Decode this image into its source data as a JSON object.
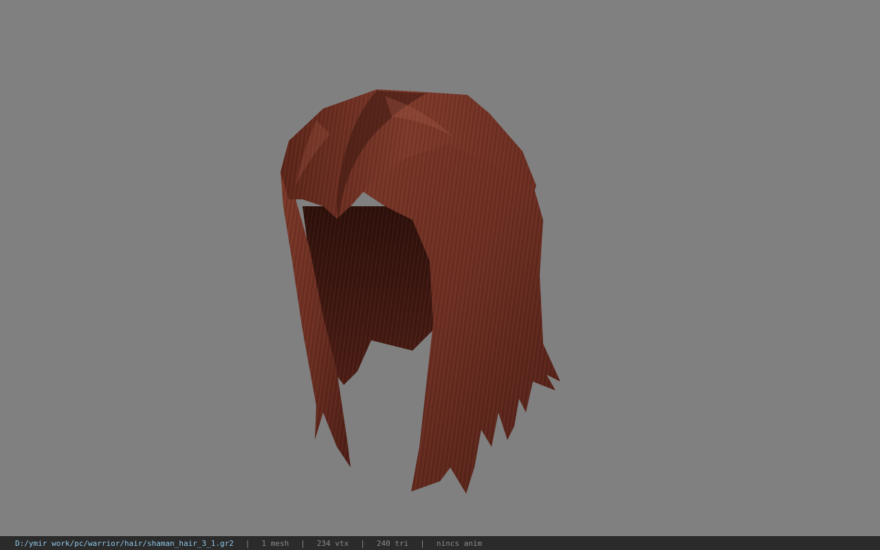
{
  "viewport": {
    "background_color": "#808080",
    "model_description_icon": "hair-mesh-render",
    "hair_base_color": "#6b2e22",
    "hair_dark_color": "#3a1510",
    "hair_light_color": "#8a4534"
  },
  "statusbar": {
    "file_path": "D:/ymir work/pc/warrior/hair/shaman_hair_3_1.gr2",
    "separator": "|",
    "mesh_count": "1 mesh",
    "vertex_count": "234 vtx",
    "triangle_count": "240 tri",
    "anim_status": "nincs anim",
    "path_color": "#8fc6e8",
    "background_color": "#2b2b2b"
  }
}
